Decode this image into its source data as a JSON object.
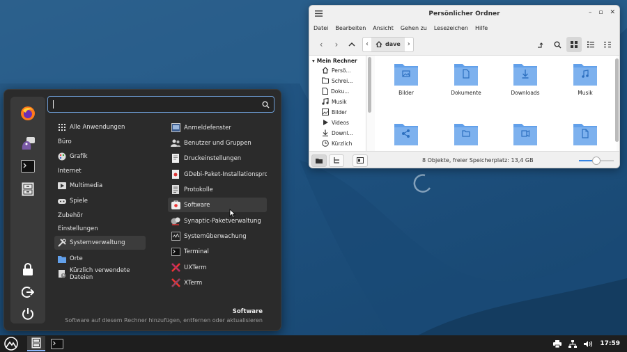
{
  "colors": {
    "accent": "#3584e4",
    "folder": "#62a0ea",
    "menu_bg": "#2b2b2b",
    "panel_bg": "#1e1e1e"
  },
  "menu": {
    "search": {
      "value": "",
      "placeholder": ""
    },
    "sidebar_icons": [
      "firefox-icon",
      "pidgin-icon",
      "terminal-icon",
      "file-cabinet-icon",
      "lock-icon",
      "logout-icon",
      "power-icon"
    ],
    "categories": [
      {
        "label": "Alle Anwendungen",
        "icon": "grid-icon"
      },
      {
        "label": "Büro",
        "icon": ""
      },
      {
        "label": "Grafik",
        "icon": "palette-icon"
      },
      {
        "label": "Internet",
        "icon": ""
      },
      {
        "label": "Multimedia",
        "icon": "multimedia-icon"
      },
      {
        "label": "Spiele",
        "icon": "gamepad-icon"
      },
      {
        "label": "Zubehör",
        "icon": ""
      },
      {
        "label": "Einstellungen",
        "icon": ""
      },
      {
        "label": "Systemverwaltung",
        "icon": "tools-icon"
      },
      {
        "label": "Orte",
        "icon": "folder-icon"
      },
      {
        "label": "Kürzlich verwendete Dateien",
        "icon": "recent-icon"
      }
    ],
    "apps": [
      {
        "label": "Anmeldefenster"
      },
      {
        "label": "Benutzer und Gruppen"
      },
      {
        "label": "Druckeinstellungen"
      },
      {
        "label": "GDebi-Paket-Installationsprog..."
      },
      {
        "label": "Protokolle"
      },
      {
        "label": "Software"
      },
      {
        "label": "Synaptic-Paketverwaltung"
      },
      {
        "label": "Systemüberwachung"
      },
      {
        "label": "Terminal"
      },
      {
        "label": "UXTerm"
      },
      {
        "label": "XTerm"
      }
    ],
    "selected_category": 8,
    "selected_app": 5,
    "description": {
      "title": "Software",
      "text": "Software auf diesem Rechner hinzufügen, entfernen oder aktualisieren"
    }
  },
  "filemanager": {
    "title": "Persönlicher Ordner",
    "menubar": [
      "Datei",
      "Bearbeiten",
      "Ansicht",
      "Gehen zu",
      "Lesezeichen",
      "Hilfe"
    ],
    "breadcrumb": "dave",
    "sidebar_heading": "Mein Rechner",
    "sidebar_items": [
      {
        "label": "Persö...",
        "icon": "home-icon"
      },
      {
        "label": "Schrei...",
        "icon": "desktop-folder-icon"
      },
      {
        "label": "Doku...",
        "icon": "document-icon"
      },
      {
        "label": "Musik",
        "icon": "music-icon"
      },
      {
        "label": "Bilder",
        "icon": "image-icon"
      },
      {
        "label": "Videos",
        "icon": "video-icon"
      },
      {
        "label": "Downl...",
        "icon": "download-icon"
      },
      {
        "label": "Kürzlich",
        "icon": "recent-icon"
      }
    ],
    "folders": [
      {
        "label": "Bilder",
        "glyph": "image"
      },
      {
        "label": "Dokumente",
        "glyph": "document"
      },
      {
        "label": "Downloads",
        "glyph": "download"
      },
      {
        "label": "Musik",
        "glyph": "music"
      },
      {
        "label": "",
        "glyph": "share"
      },
      {
        "label": "",
        "glyph": "folder"
      },
      {
        "label": "",
        "glyph": "video"
      },
      {
        "label": "",
        "glyph": "template"
      }
    ],
    "status": "8 Objekte, freier Speicherplatz: 13,4 GB",
    "zoom_level": 0.5
  },
  "panel": {
    "clock": "17:59",
    "tray": [
      "printer-icon",
      "network-icon",
      "volume-icon"
    ]
  }
}
